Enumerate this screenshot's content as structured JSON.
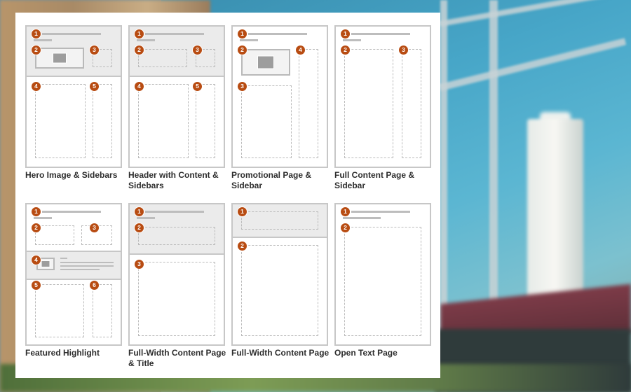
{
  "layouts": [
    {
      "title": "Hero Image & Sidebars",
      "badges": [
        "1",
        "2",
        "3",
        "4",
        "5"
      ]
    },
    {
      "title": "Header with Content & Sidebars",
      "badges": [
        "1",
        "2",
        "3",
        "4",
        "5"
      ]
    },
    {
      "title": "Promotional Page & Sidebar",
      "badges": [
        "1",
        "2",
        "3",
        "4"
      ]
    },
    {
      "title": "Full Content Page & Sidebar",
      "badges": [
        "1",
        "2",
        "3"
      ]
    },
    {
      "title": "Featured Highlight",
      "badges": [
        "1",
        "2",
        "3",
        "4",
        "5",
        "6"
      ]
    },
    {
      "title": "Full-Width Content Page & Title",
      "badges": [
        "1",
        "2",
        "3"
      ]
    },
    {
      "title": "Full-Width Content Page",
      "badges": [
        "1",
        "2"
      ]
    },
    {
      "title": "Open Text Page",
      "badges": [
        "1",
        "2"
      ]
    }
  ],
  "colors": {
    "badge": "#b84c12",
    "frame_border": "#c7c7c7",
    "shaded_region": "#ebebeb"
  },
  "icons": {
    "image_placeholder": "image-icon"
  }
}
